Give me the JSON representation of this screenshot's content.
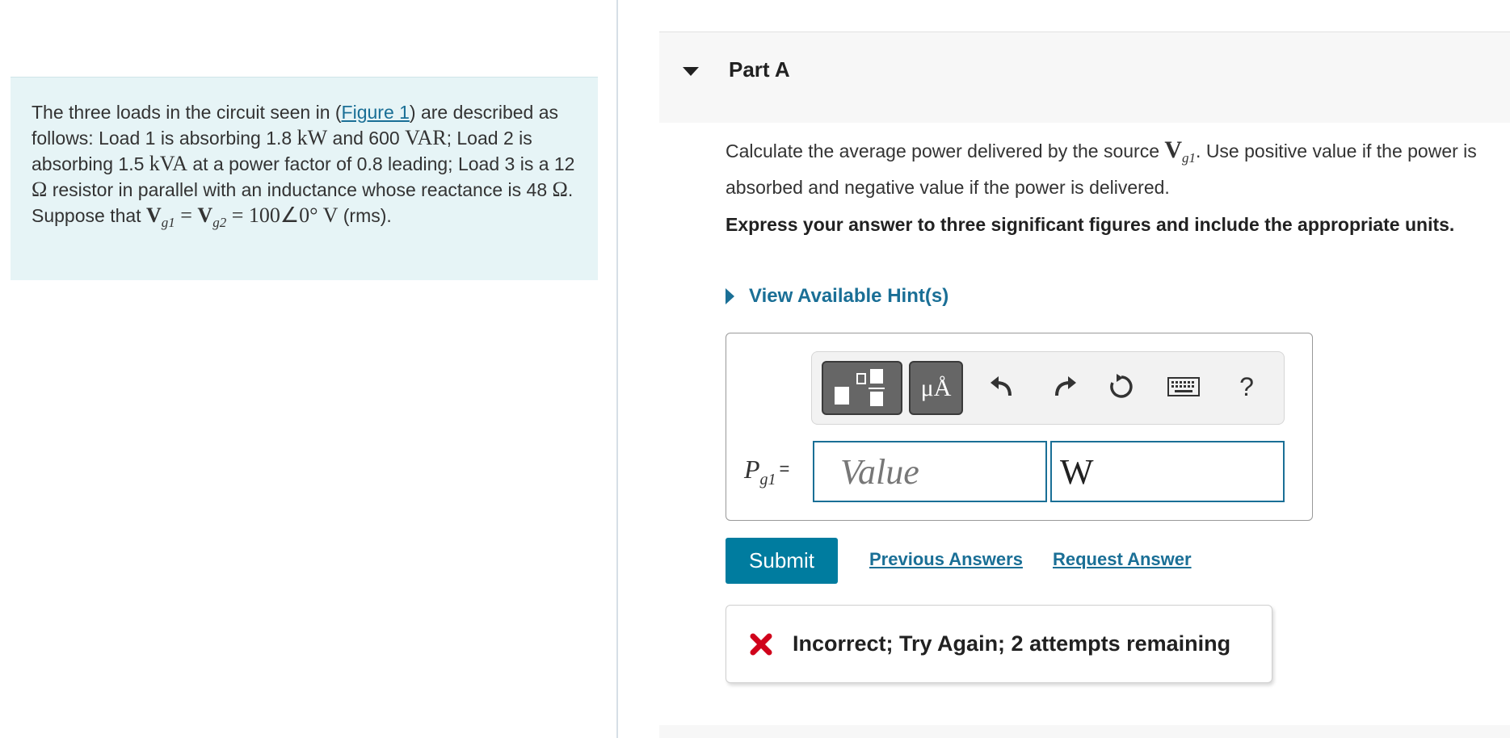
{
  "problem": {
    "before_link": "The three loads in the circuit seen in (",
    "figure_link": "Figure 1",
    "after_link": ") are described as follows: Load 1 is absorbing 1.8 ",
    "kW": "kW",
    "and_text": " and 600 ",
    "VAR": "VAR",
    "load2_text": "; Load 2 is absorbing 1.5 ",
    "kVA": "kVA",
    "pf_text": " at a power factor of 0.8 leading; Load 3 is a 12 ",
    "ohm1": "Ω",
    "resistor_text": " resistor in parallel with an inductance whose reactance is 48 ",
    "ohm2": "Ω",
    "suppose_text": ". Suppose that ",
    "V": "V",
    "g1": "g1",
    "g2": "g2",
    "eq": " = ",
    "phasor": "100∠0° V",
    "rms_text": " (rms)."
  },
  "part": {
    "title": "Part A"
  },
  "question": {
    "text_before": "Calculate the average power delivered by the source ",
    "V": "V",
    "sub": "g1",
    "text_after": ". Use positive value if the power is absorbed and negative value if the power is delivered.",
    "instruction": "Express your answer to three significant figures and include the appropriate units."
  },
  "hints": {
    "label": "View Available Hint(s)"
  },
  "toolbar": {
    "template_icon": "fraction-template-icon",
    "units_label": "μÅ",
    "undo_icon": "undo-icon",
    "redo_icon": "redo-icon",
    "reset_icon": "reset-icon",
    "keyboard_icon": "keyboard-icon",
    "help_label": "?"
  },
  "answer": {
    "label_P": "P",
    "label_sub": "g1",
    "label_eq": "=",
    "value_placeholder": "Value",
    "value": "",
    "units_value": "W"
  },
  "actions": {
    "submit": "Submit",
    "previous_answers": "Previous Answers",
    "request_answer": "Request Answer"
  },
  "feedback": {
    "text": "Incorrect; Try Again; 2 attempts remaining",
    "icon": "x-mark-icon",
    "color": "#d0021b"
  },
  "colors": {
    "accent": "#1a6f96",
    "submit_bg": "#007c9f",
    "problem_bg": "#e6f4f6"
  }
}
